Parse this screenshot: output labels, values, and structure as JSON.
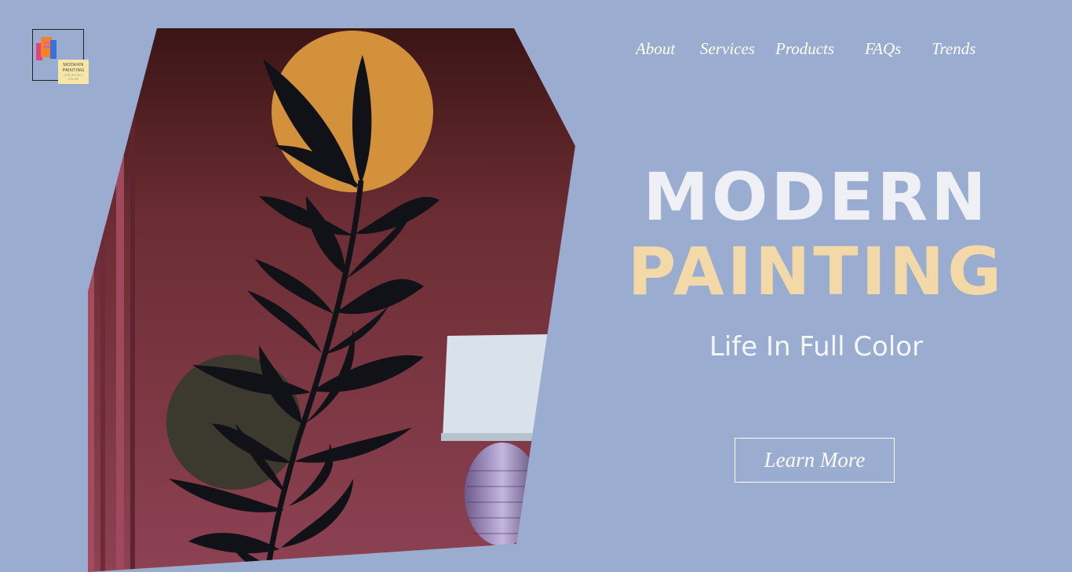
{
  "logo": {
    "line1": "MODERN",
    "line2": "PAINTING",
    "tagline": "LIFE IN FULL COLOR",
    "colors": [
      "#e0457a",
      "#f4822a",
      "#3b6fd9",
      "#f7e6a6"
    ]
  },
  "nav": {
    "items": [
      {
        "label": "About"
      },
      {
        "label": "Services"
      },
      {
        "label": "Products"
      },
      {
        "label": "FAQs"
      },
      {
        "label": "Trends"
      }
    ]
  },
  "hero": {
    "title_line1": "MODERN",
    "title_line2": "PAINTING",
    "subtitle": "Life In Full Color",
    "cta_label": "Learn More"
  },
  "colors": {
    "background": "#9aaccf",
    "title_primary": "#eef0f6",
    "title_accent": "#f4d9a8",
    "wall": "#8a3f4f",
    "sun": "#d2913a",
    "moon": "#3c3a2e",
    "leaves": "#101217"
  }
}
